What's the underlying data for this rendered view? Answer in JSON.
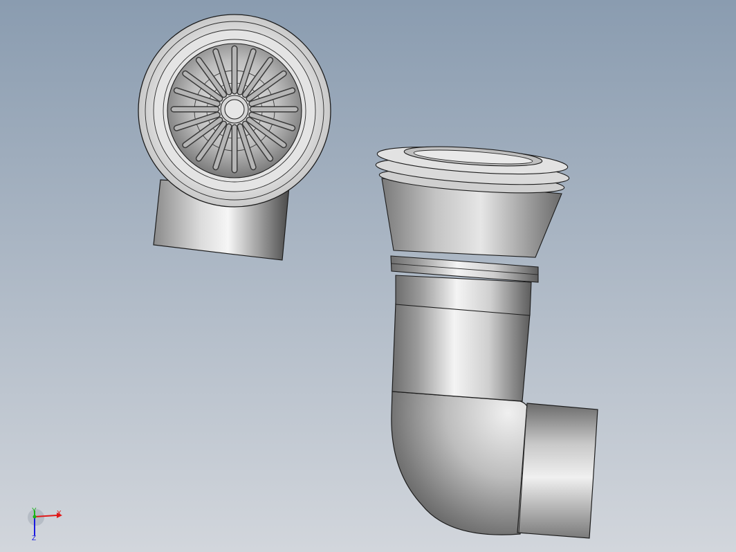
{
  "viewport": {
    "background_top": "#8a9cb0",
    "background_bottom": "#d2d6dc"
  },
  "parts": [
    {
      "name": "drain-cover-strainer"
    },
    {
      "name": "elbow-trap-pipe"
    }
  ],
  "triad": {
    "x_label": "X",
    "y_label": "Y",
    "z_label": "Z",
    "x_color": "#e01818",
    "y_color": "#18b418",
    "z_color": "#1818e0"
  }
}
